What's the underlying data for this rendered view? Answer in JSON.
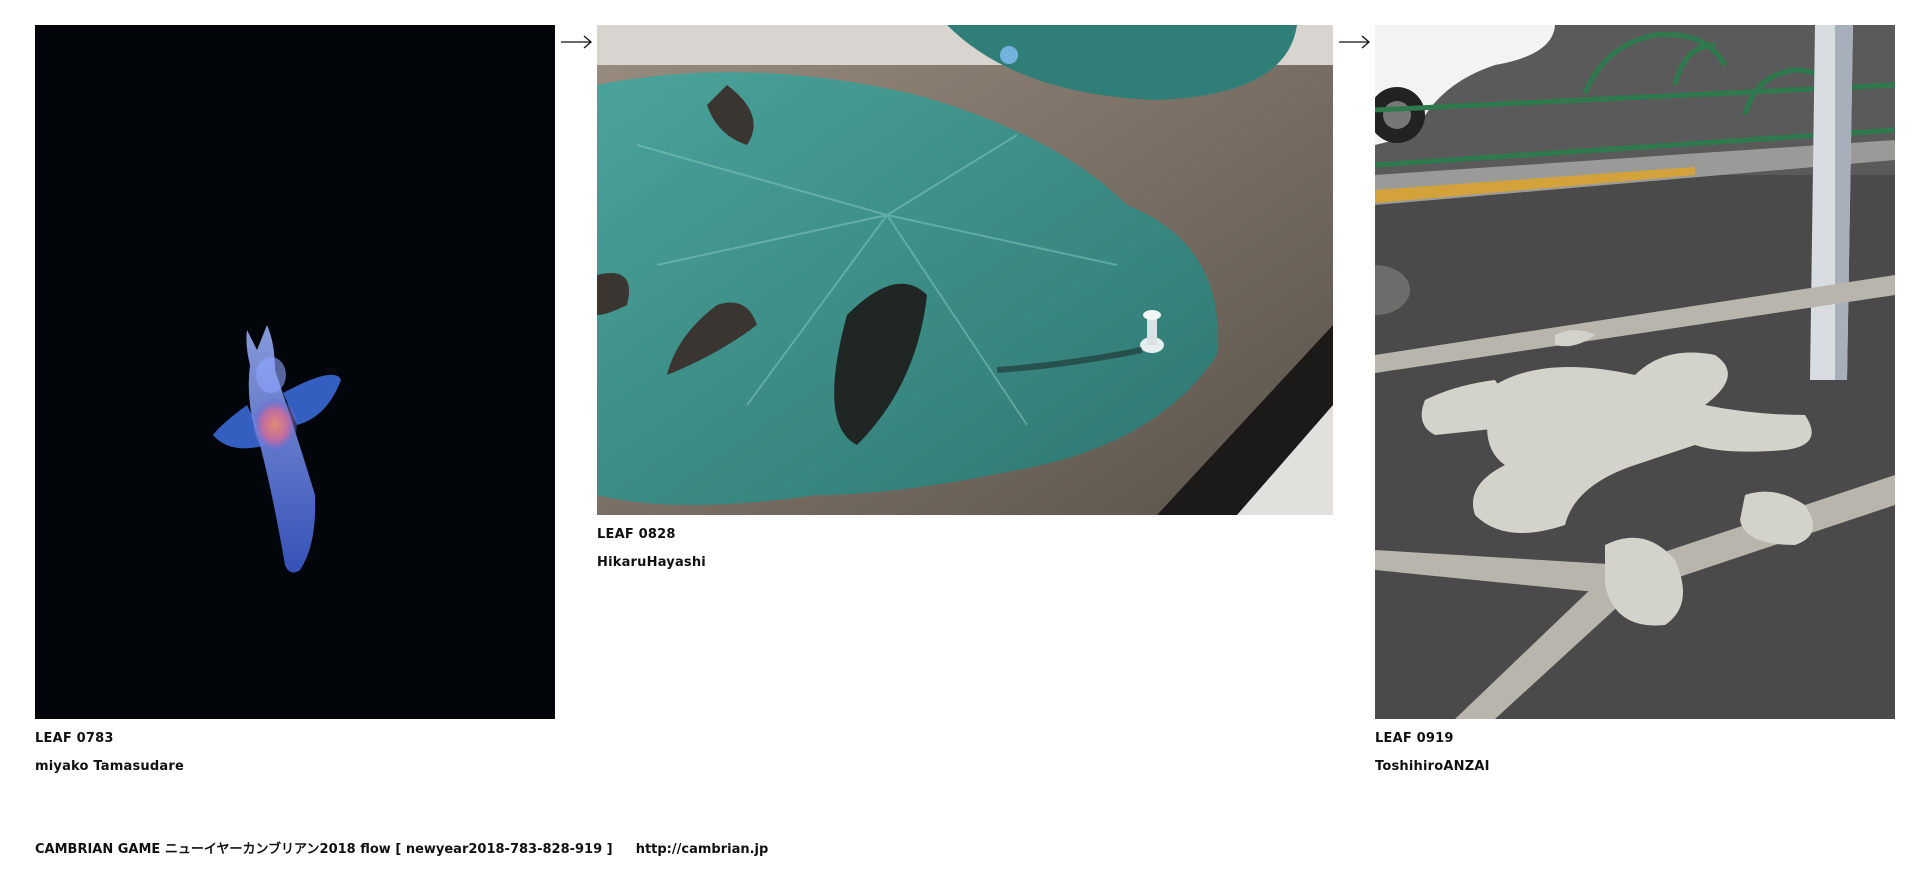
{
  "leaves": [
    {
      "title": "LEAF 0783",
      "author": "miyako Tamasudare",
      "image": "sea-angel-photo"
    },
    {
      "title": "LEAF 0828",
      "author": "HikaruHayashi",
      "image": "monstera-leaf-photo"
    },
    {
      "title": "LEAF 0919",
      "author": "ToshihiroANZAI",
      "image": "road-patch-photo"
    }
  ],
  "footer": {
    "text": "CAMBRIAN GAME  ニューイヤーカンブリアン2018  flow [ newyear2018-783-828-919 ]",
    "link": "http://cambrian.jp"
  }
}
